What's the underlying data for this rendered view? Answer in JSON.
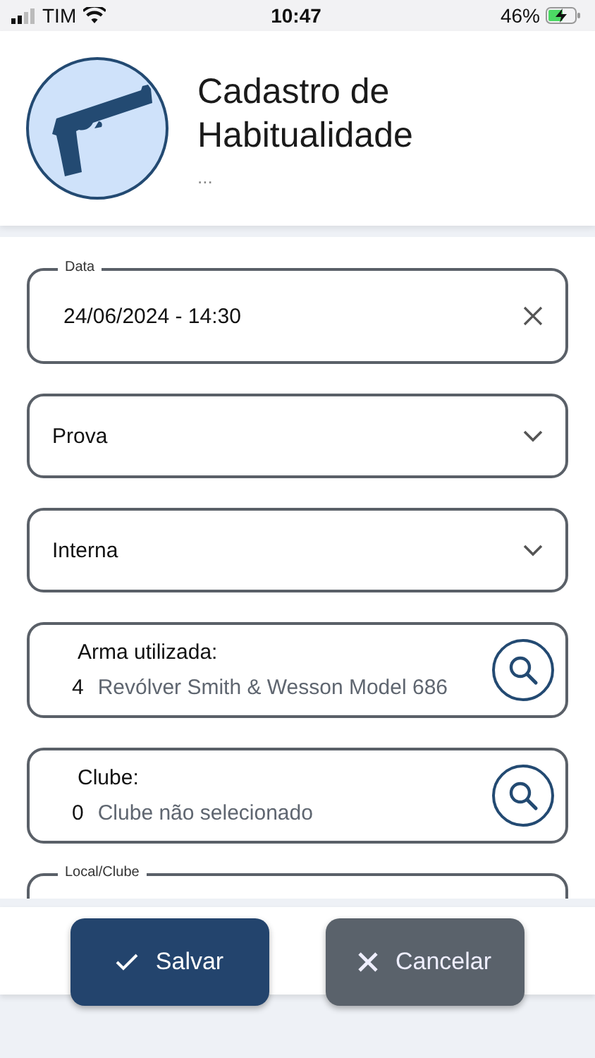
{
  "status_bar": {
    "carrier": "TIM",
    "time": "10:47",
    "battery": "46%"
  },
  "header": {
    "title": "Cadastro de Habitualidade",
    "subtitle": "..."
  },
  "fields": [
    {
      "kind": "date",
      "label": "Data",
      "value": "24/06/2024 - 14:30"
    },
    {
      "kind": "select",
      "value": "Prova"
    },
    {
      "kind": "select",
      "value": "Interna"
    },
    {
      "kind": "lookup",
      "label": "Arma utilizada:",
      "code": "4",
      "value": "Revólver Smith & Wesson Model 686"
    },
    {
      "kind": "lookup",
      "label": "Clube:",
      "code": "0",
      "value": "Clube não selecionado"
    },
    {
      "kind": "select",
      "label": "Local/Clube"
    }
  ],
  "buttons": [
    {
      "kind": "primary",
      "label": "Salvar"
    },
    {
      "kind": "secondary",
      "label": "Cancelar"
    }
  ]
}
